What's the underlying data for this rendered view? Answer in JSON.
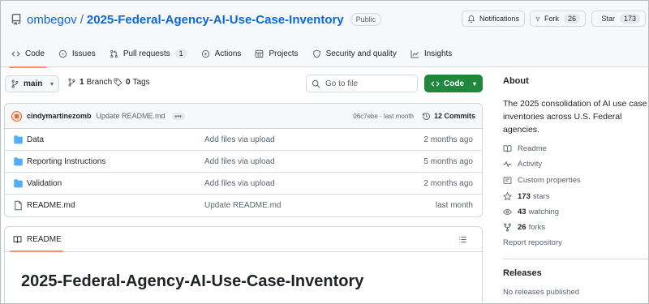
{
  "repo": {
    "owner": "ombegov",
    "separator": "/",
    "name": "2025-Federal-Agency-AI-Use-Case-Inventory",
    "visibility": "Public"
  },
  "actions": {
    "notifications_label": "Notifications",
    "fork_label": "Fork",
    "fork_count": "26",
    "star_label": "Star",
    "star_count": "173"
  },
  "tabs": [
    {
      "label": "Code",
      "icon": "code-icon",
      "active": true
    },
    {
      "label": "Issues",
      "icon": "issue-icon"
    },
    {
      "label": "Pull requests",
      "icon": "pull-request-icon",
      "count": "1"
    },
    {
      "label": "Actions",
      "icon": "play-icon"
    },
    {
      "label": "Projects",
      "icon": "table-icon"
    },
    {
      "label": "Security and quality",
      "icon": "shield-icon"
    },
    {
      "label": "Insights",
      "icon": "graph-icon"
    }
  ],
  "toolbar": {
    "branch": "main",
    "branches_count": "1",
    "branches_label": "Branch",
    "tags_count": "0",
    "tags_label": "Tags",
    "search_placeholder": "Go to file",
    "code_button": "Code"
  },
  "commit": {
    "author": "cindymartinezomb",
    "message": "Update README.md",
    "dots": "•••",
    "hash_time": "06c7ebe · last month",
    "commits_count": "12 Commits"
  },
  "files": [
    {
      "name": "Data",
      "type": "folder",
      "message": "Add files via upload",
      "date": "2 months ago"
    },
    {
      "name": "Reporting Instructions",
      "type": "folder",
      "message": "Add files via upload",
      "date": "5 months ago"
    },
    {
      "name": "Validation",
      "type": "folder",
      "message": "Add files via upload",
      "date": "2 months ago"
    },
    {
      "name": "README.md",
      "type": "file",
      "message": "Update README.md",
      "date": "last month"
    }
  ],
  "readme": {
    "tab_label": "README",
    "heading": "2025-Federal-Agency-AI-Use-Case-Inventory"
  },
  "about": {
    "title": "About",
    "description": "The 2025 consolidation of AI use case inventories across U.S. Federal agencies.",
    "readme_link": "Readme",
    "activity_link": "Activity",
    "custom_properties_link": "Custom properties",
    "stars_count": "173",
    "stars_label": "stars",
    "watching_count": "43",
    "watching_label": "watching",
    "forks_count": "26",
    "forks_label": "forks",
    "report_link": "Report repository"
  },
  "releases": {
    "title": "Releases",
    "subtitle": "No releases published"
  },
  "colors": {
    "link": "#0969da",
    "primary_button": "#1f883d",
    "active_tab_underline": "#fd8c73",
    "folder": "#54aeff"
  }
}
